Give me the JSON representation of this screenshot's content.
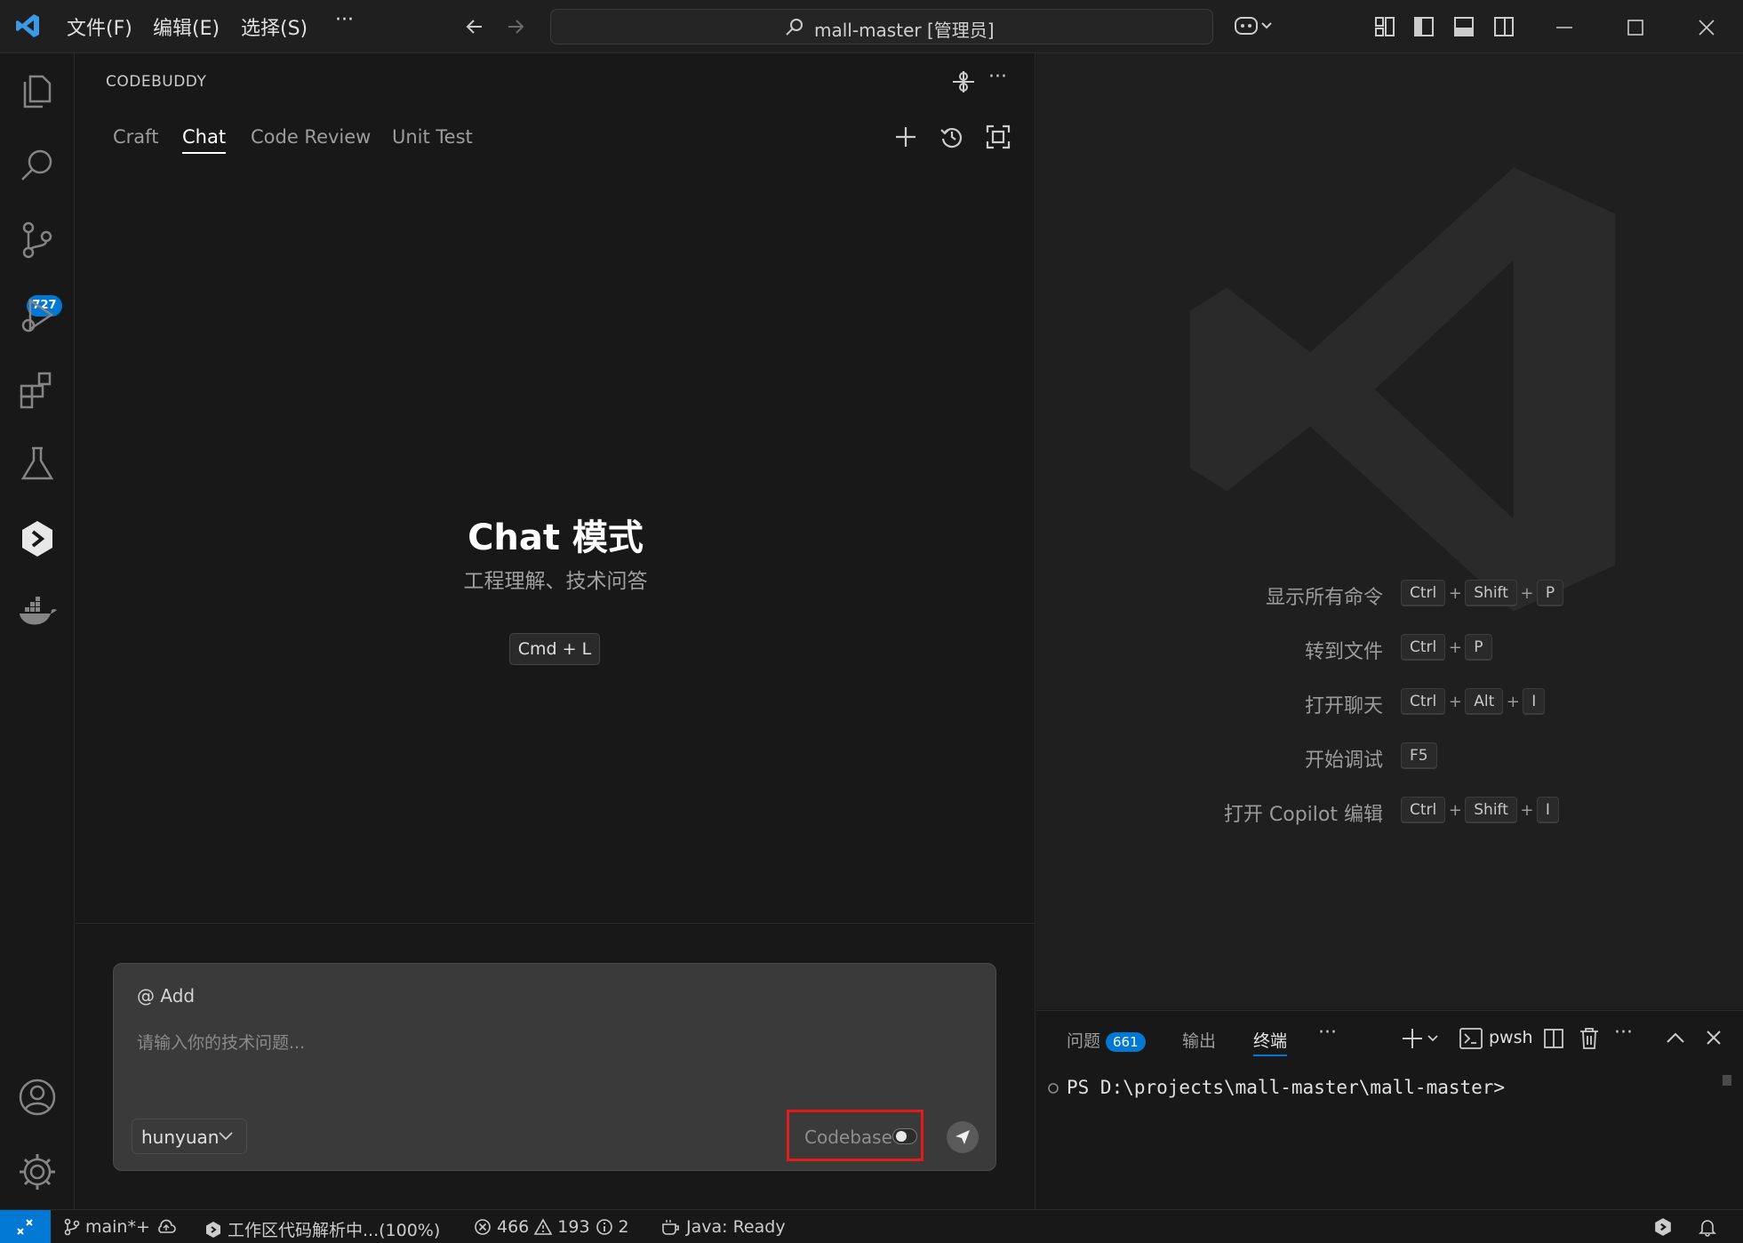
{
  "titlebar": {
    "menus": [
      "文件(F)",
      "编辑(E)",
      "选择(S)"
    ],
    "more": "···",
    "search_title": "mall-master [管理员]"
  },
  "activitybar": {
    "items": [
      "explorer-icon",
      "search-icon",
      "source-control-icon",
      "run-debug-icon",
      "extensions-icon",
      "testing-icon",
      "codebuddy-icon",
      "docker-icon"
    ],
    "scm_badge": "727",
    "bottom": [
      "account-icon",
      "settings-gear-icon"
    ]
  },
  "sidepanel": {
    "title": "CODEBUDDY",
    "tabs": [
      {
        "label": "Craft",
        "active": false
      },
      {
        "label": "Chat",
        "active": true
      },
      {
        "label": "Code Review",
        "active": false
      },
      {
        "label": "Unit Test",
        "active": false
      }
    ],
    "hero_title": "Chat 模式",
    "hero_subtitle": "工程理解、技术问答",
    "shortcut": "Cmd + L",
    "input": {
      "add_label": "@ Add",
      "placeholder": "请输入你的技术问题...",
      "model": "hunyuan",
      "codebase_label": "Codebase",
      "codebase_enabled": false
    }
  },
  "editor": {
    "hints": [
      {
        "label": "显示所有命令",
        "keys": [
          "Ctrl",
          "Shift",
          "P"
        ]
      },
      {
        "label": "转到文件",
        "keys": [
          "Ctrl",
          "P"
        ]
      },
      {
        "label": "打开聊天",
        "keys": [
          "Ctrl",
          "Alt",
          "I"
        ]
      },
      {
        "label": "开始调试",
        "keys": [
          "F5"
        ]
      },
      {
        "label": "打开 Copilot 编辑",
        "keys": [
          "Ctrl",
          "Shift",
          "I"
        ]
      }
    ]
  },
  "panel": {
    "tabs": [
      {
        "label": "问题",
        "badge": "661"
      },
      {
        "label": "输出"
      },
      {
        "label": "终端",
        "active": true
      }
    ],
    "more": "···",
    "shell": "pwsh",
    "prompt": "PS D:\\projects\\mall-master\\mall-master>"
  },
  "statusbar": {
    "branch": "main*+",
    "indexing": "工作区代码解析中...(100%)",
    "errors": "466",
    "warnings": "193",
    "infos": "2",
    "java": "Java: Ready"
  },
  "colors": {
    "accent": "#0078d4",
    "highlight_box": "#e21b1b",
    "background": "#181818"
  }
}
